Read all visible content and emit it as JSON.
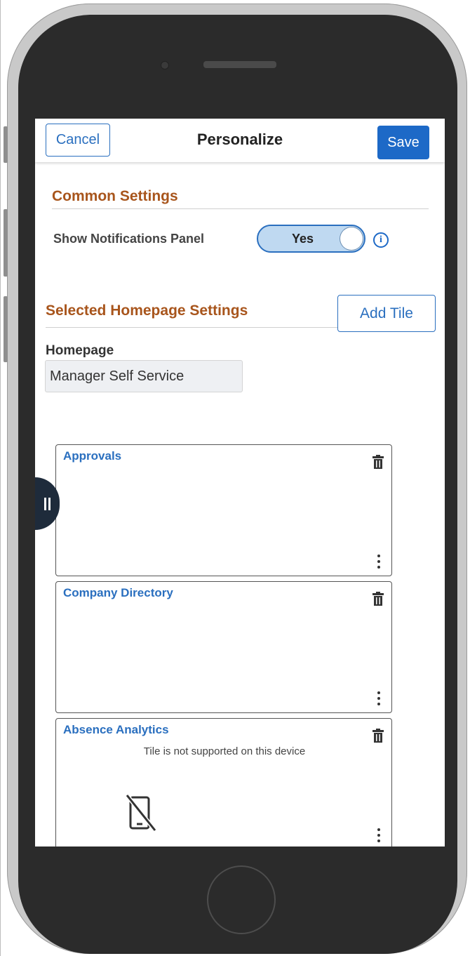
{
  "header": {
    "cancel_label": "Cancel",
    "title": "Personalize",
    "save_label": "Save"
  },
  "common_settings": {
    "title": "Common Settings",
    "notifications_label": "Show Notifications Panel",
    "notifications_value": "Yes"
  },
  "homepage_settings": {
    "title": "Selected Homepage Settings",
    "add_tile_label": "Add Tile",
    "homepage_label": "Homepage",
    "homepage_value": "Manager Self Service"
  },
  "tiles": [
    {
      "title": "Approvals",
      "message": ""
    },
    {
      "title": "Company Directory",
      "message": ""
    },
    {
      "title": "Absence Analytics",
      "message": "Tile is not supported on this device"
    }
  ],
  "colors": {
    "accent": "#1d69c7",
    "section_title": "#a8551c",
    "toggle_on": "#bfd9f1"
  },
  "icons": [
    "info-icon",
    "trash-icon",
    "more-vertical-icon",
    "no-mobile-device-icon",
    "drawer-handle-icon"
  ]
}
